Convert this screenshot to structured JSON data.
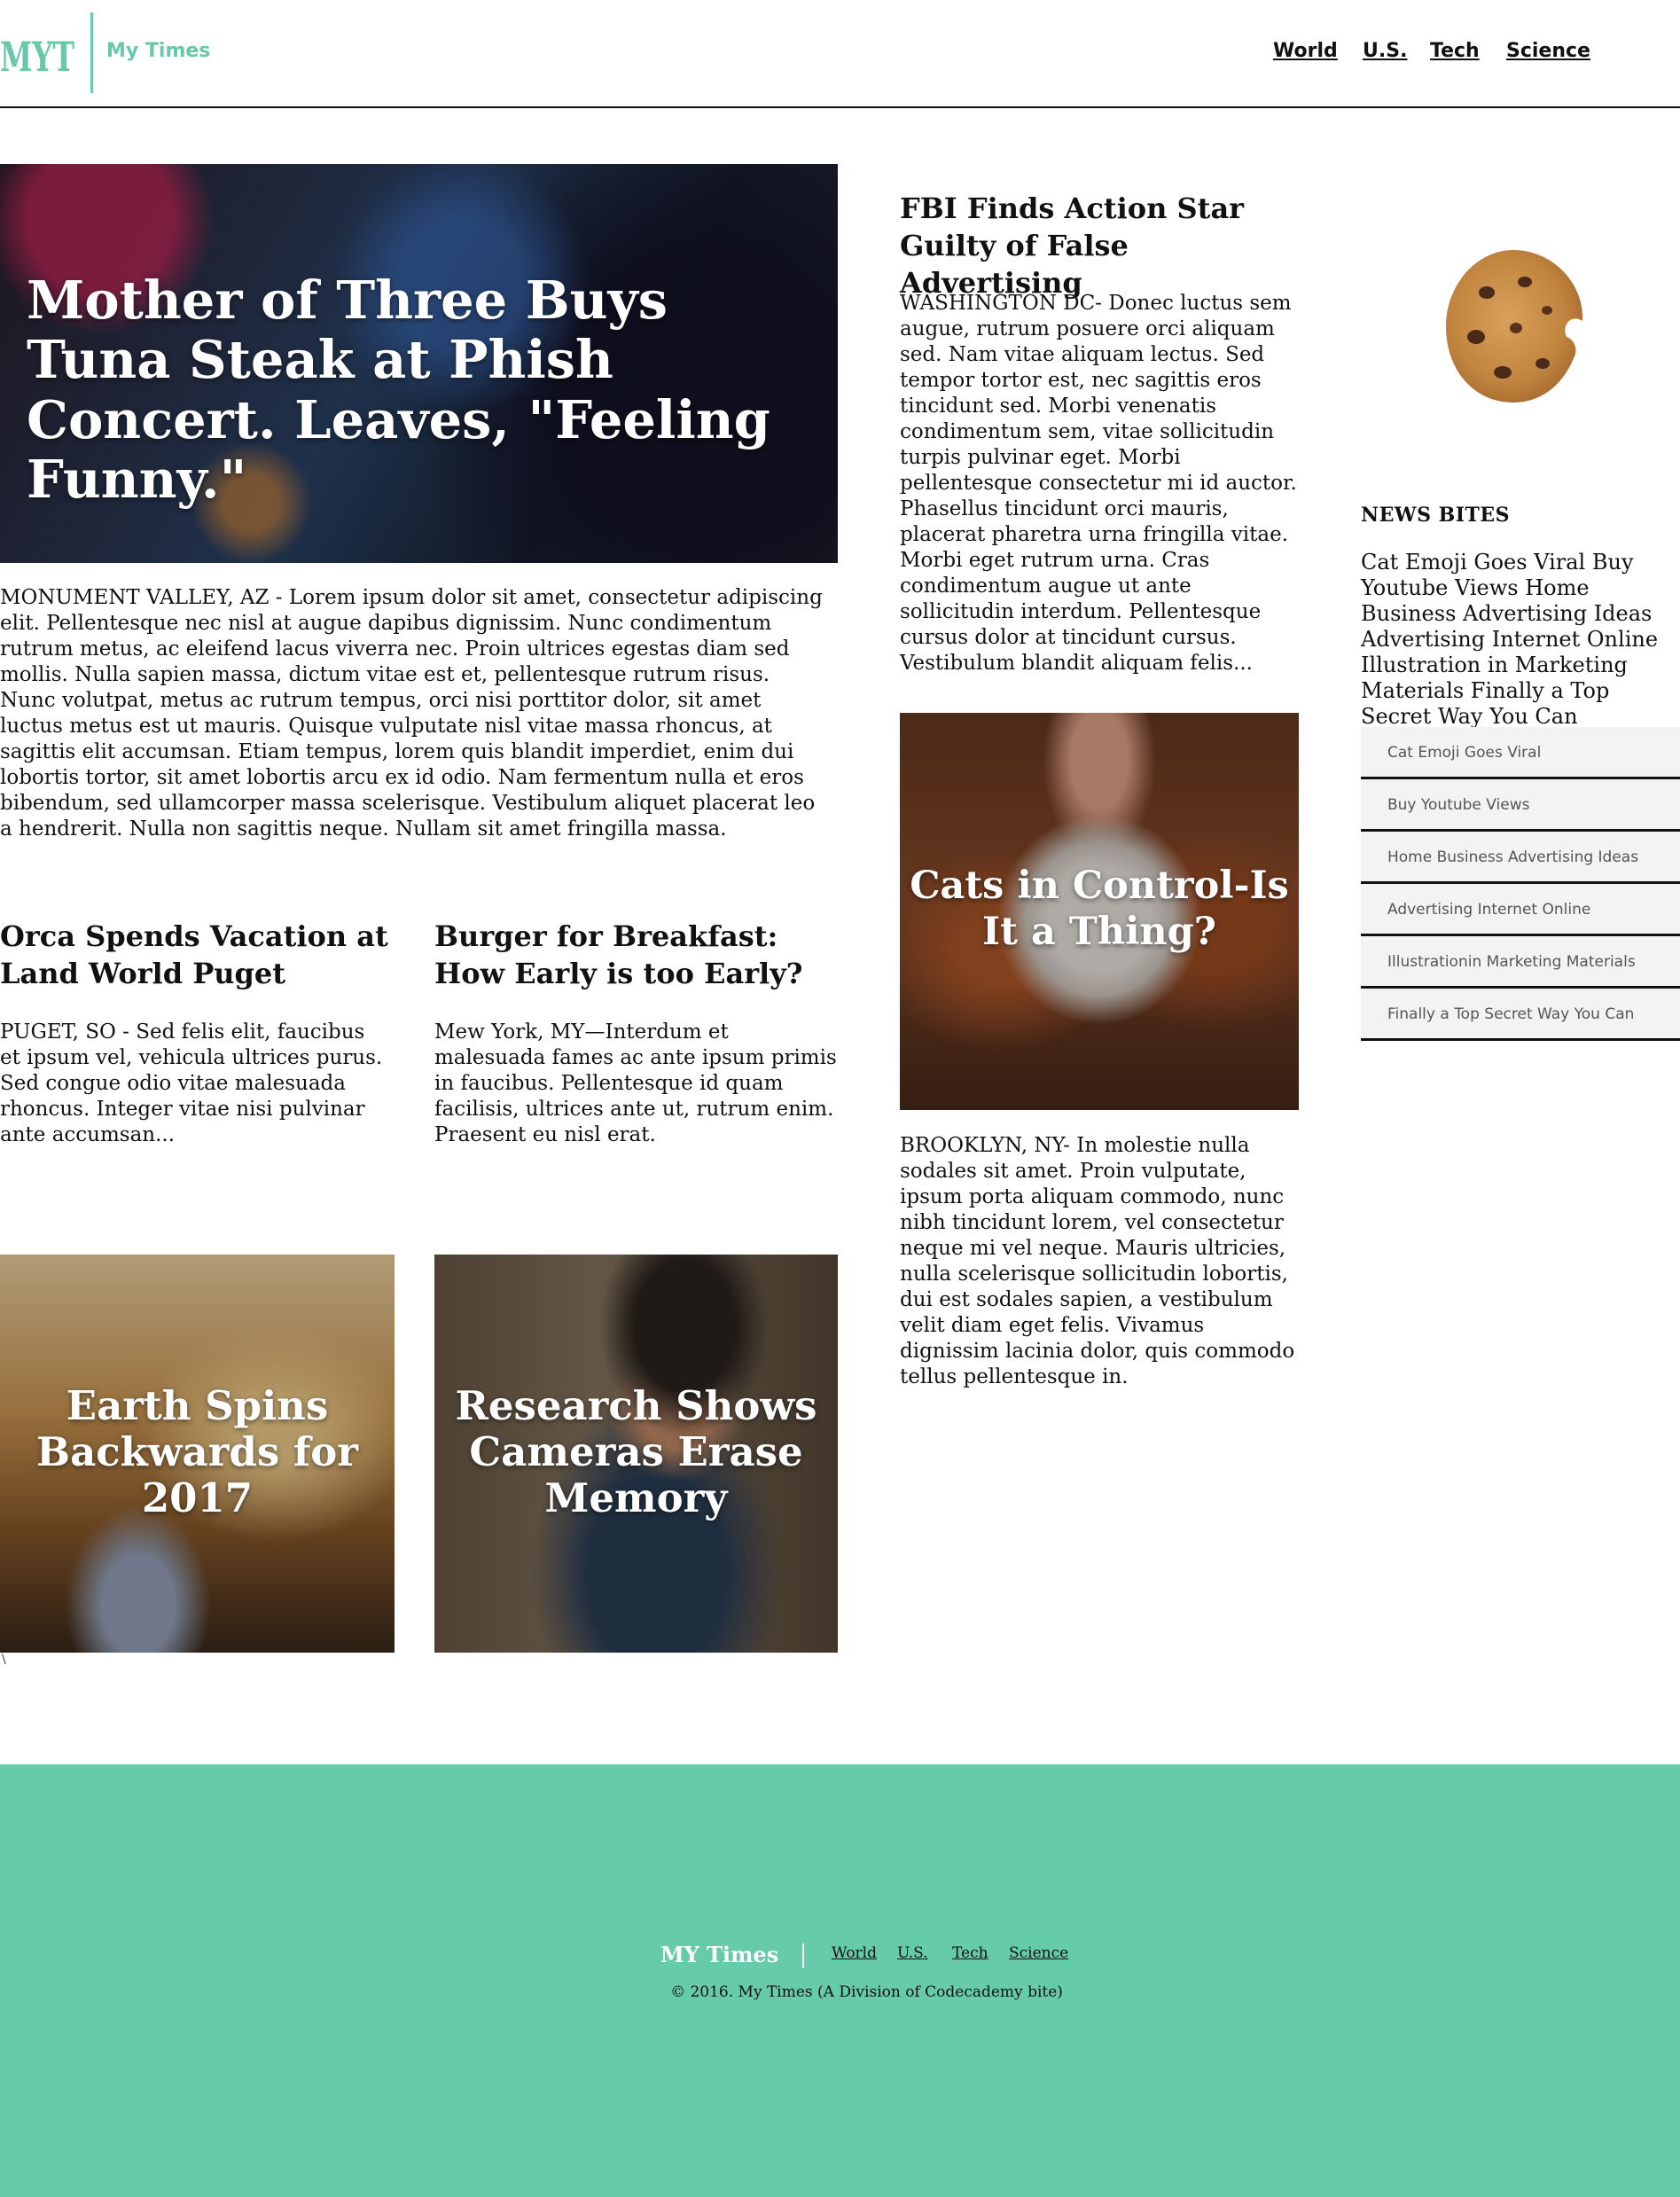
{
  "header": {
    "logo_text": "MYT",
    "brand": "My Times",
    "nav": [
      "World",
      "U.S.",
      "Tech",
      "Science"
    ]
  },
  "hero": {
    "title": "Mother of Three Buys Tuna Steak at Phish Concert. Leaves, \"Feeling Funny.\"",
    "body": "MONUMENT VALLEY, AZ - Lorem ipsum dolor sit amet, consectetur adipiscing elit. Pellentesque nec nisl at augue dapibus dignissim. Nunc condimentum rutrum metus, ac eleifend lacus viverra nec. Proin ultrices egestas diam sed mollis. Nulla sapien massa, dictum vitae est et, pellentesque rutrum risus. Nunc volutpat, metus ac rutrum tempus, orci nisi porttitor dolor, sit amet luctus metus est ut mauris. Quisque vulputate nisl vitae massa rhoncus, at sagittis elit accumsan. Etiam tempus, lorem quis blandit imperdiet, enim dui lobortis tortor, sit amet lobortis arcu ex id odio. Nam fermentum nulla et eros bibendum, sed ullamcorper massa scelerisque. Vestibulum aliquet placerat leo a hendrerit. Nulla non sagittis neque. Nullam sit amet fringilla massa."
  },
  "orca": {
    "title": "Orca Spends Vacation at Land World Puget",
    "body": "PUGET, SO - Sed felis elit, faucibus et ipsum vel, vehicula ultrices purus. Sed congue odio vitae malesuada rhoncus. Integer vitae nisi pulvinar ante accumsan..."
  },
  "burger": {
    "title": "Burger for Breakfast: How Early is too Early?",
    "body": "Mew York, MY—Interdum et malesuada fames ac ante ipsum primis in faucibus. Pellentesque id quam facilisis, ultrices ante ut, rutrum enim. Praesent eu nisl erat."
  },
  "earth": {
    "title": "Earth Spins Backwards for 2017"
  },
  "camera": {
    "title": "Research Shows Cameras Erase Memory"
  },
  "stray_char": "\\",
  "fbi": {
    "title": "FBI Finds Action Star Guilty of False Advertising",
    "body": "WASHINGTON DC- Donec luctus sem augue, rutrum posuere orci aliquam sed. Nam vitae aliquam lectus. Sed tempor tortor est, nec sagittis eros tincidunt sed. Morbi venenatis condimentum sem, vitae sollicitudin turpis pulvinar eget. Morbi pellentesque consectetur mi id auctor. Phasellus tincidunt orci mauris, placerat pharetra urna fringilla vitae. Morbi eget rutrum urna. Cras condimentum augue ut ante sollicitudin interdum. Pellentesque cursus dolor at tincidunt cursus. Vestibulum blandit aliquam felis..."
  },
  "cats": {
    "title": "Cats in Control-Is It a Thing?",
    "body": "BROOKLYN, NY- In molestie nulla sodales sit amet. Proin vulputate, ipsum porta aliquam commodo, nunc nibh tincidunt lorem, vel consectetur neque mi vel neque. Mauris ultricies, nulla scelerisque sollicitudin lobortis, dui est sodales sapien, a vestibulum velit diam eget felis. Vivamus dignissim lacinia dolor, quis commodo tellus pellentesque in."
  },
  "news_bites": {
    "title": "NEWS BITES",
    "text": "Cat Emoji Goes Viral Buy Youtube Views Home Business Advertising Ideas Advertising Internet Online Illustration in Marketing Materials Finally a Top Secret Way You Can",
    "items": [
      "Cat Emoji Goes Viral",
      "Buy Youtube Views",
      "Home Business Advertising Ideas",
      "Advertising Internet Online",
      "Illustrationin Marketing Materials",
      "Finally a Top Secret Way You Can"
    ]
  },
  "footer": {
    "brand": "MY Times",
    "nav": [
      "World",
      "U.S.",
      "Tech",
      "Science"
    ],
    "copyright": "© 2016. My Times (A Division of Codecademy bite)"
  },
  "colors": {
    "accent": "#67c9a7",
    "footer_bg": "#66cba8",
    "text": "#111111"
  }
}
